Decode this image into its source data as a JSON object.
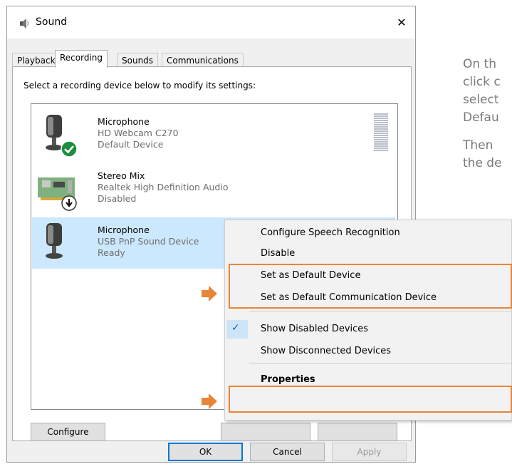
{
  "window": {
    "title": "Sound"
  },
  "tabs": [
    {
      "label": "Playback"
    },
    {
      "label": "Recording"
    },
    {
      "label": "Sounds"
    },
    {
      "label": "Communications"
    }
  ],
  "instruction": "Select a recording device below to modify its settings:",
  "devices": [
    {
      "name": "Microphone",
      "model": "HD Webcam C270",
      "status": "Default Device"
    },
    {
      "name": "Stereo Mix",
      "model": "Realtek High Definition Audio",
      "status": "Disabled"
    },
    {
      "name": "Microphone",
      "model": "USB PnP Sound Device",
      "status": "Ready"
    }
  ],
  "buttons": {
    "configure": "Configure",
    "ok": "OK",
    "cancel": "Cancel",
    "apply": "Apply"
  },
  "context_menu": {
    "items": [
      "Configure Speech Recognition",
      "Disable",
      "Set as Default Device",
      "Set as Default Communication Device",
      "Show Disabled Devices",
      "Show Disconnected Devices",
      "Properties"
    ]
  },
  "side_text": {
    "line1": "On th",
    "line2": "click c",
    "line3": "select",
    "line4": "Defau",
    "line5": "Then",
    "line6": "the de"
  },
  "colors": {
    "accent": "#0078d7",
    "highlight": "#e8853a",
    "selection": "#cce8ff"
  }
}
